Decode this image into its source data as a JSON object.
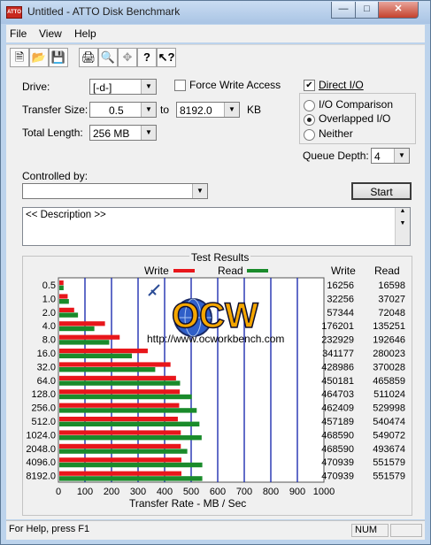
{
  "window": {
    "title": "Untitled - ATTO Disk Benchmark",
    "app_icon_text": "ATTO"
  },
  "menu": [
    "File",
    "View",
    "Help"
  ],
  "toolbar": {
    "icons": [
      "new-file-icon",
      "open-folder-icon",
      "save-icon",
      "print-icon",
      "print-preview-icon",
      "move-icon",
      "help-icon",
      "context-help-icon"
    ]
  },
  "settings": {
    "drive_label": "Drive:",
    "drive_value": "[-d-]",
    "force_write_label": "Force Write Access",
    "force_write_checked": false,
    "direct_io_label": "Direct I/O",
    "direct_io_checked": true,
    "transfer_size_label": "Transfer Size:",
    "transfer_from": "0.5",
    "to_label": "to",
    "transfer_to": "8192.0",
    "kb_label": "KB",
    "total_length_label": "Total Length:",
    "total_length_value": "256 MB",
    "io_comparison_label": "I/O Comparison",
    "overlapped_io_label": "Overlapped I/O",
    "neither_label": "Neither",
    "io_mode_selected": "overlapped",
    "queue_depth_label": "Queue Depth:",
    "queue_depth_value": "4",
    "controlled_by_label": "Controlled by:",
    "controlled_by_value": "",
    "start_label": "Start",
    "description_text": "<< Description >>"
  },
  "results": {
    "title": "Test Results",
    "legend": {
      "write": "Write",
      "read": "Read"
    },
    "col_write": "Write",
    "col_read": "Read",
    "watermark_logo": "OCW",
    "watermark_url": "http://www.ocworkbench.com"
  },
  "colors": {
    "write": "#e8161b",
    "read": "#1a8b2b",
    "grid": "#1f2fb0"
  },
  "chart_data": {
    "type": "bar",
    "orientation": "horizontal",
    "title": "Test Results",
    "xlabel": "Transfer Rate - MB / Sec",
    "xlim": [
      0,
      1000
    ],
    "xticks": [
      0,
      100,
      200,
      300,
      400,
      500,
      600,
      700,
      800,
      900,
      1000
    ],
    "grid": true,
    "legend_position": "top",
    "categories": [
      "0.5",
      "1.0",
      "2.0",
      "4.0",
      "8.0",
      "16.0",
      "32.0",
      "64.0",
      "128.0",
      "256.0",
      "512.0",
      "1024.0",
      "2048.0",
      "4096.0",
      "8192.0"
    ],
    "series": [
      {
        "name": "Write",
        "values": [
          16256,
          32256,
          57344,
          176201,
          232929,
          341177,
          428986,
          450181,
          464703,
          462409,
          457189,
          468590,
          468590,
          470939,
          470939
        ]
      },
      {
        "name": "Read",
        "values": [
          16598,
          37027,
          72048,
          135251,
          192646,
          280023,
          370028,
          465859,
          511024,
          529998,
          540474,
          549072,
          493674,
          551579,
          551579
        ]
      }
    ]
  },
  "statusbar": {
    "help_text": "For Help, press F1",
    "num": "NUM"
  }
}
